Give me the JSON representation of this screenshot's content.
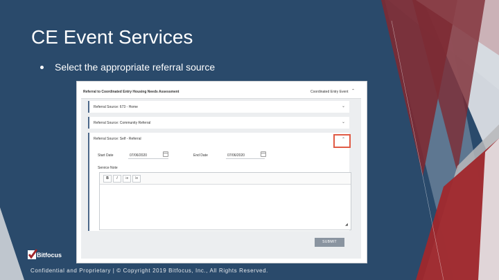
{
  "slide": {
    "title": "CE Event Services",
    "bullet": "Select the appropriate referral source",
    "footer": "Confidential and Proprietary | © Copyright 2019 Bitfocus, Inc., All Rights Reserved.",
    "logo_text": "Bitfocus"
  },
  "app": {
    "page_header": "Referral to Coordinated Entry Housing Needs Assessment",
    "header_right": "Coordinated Entry Event",
    "panels": [
      {
        "label": "Referral Source: 673 - Home"
      },
      {
        "label": "Referral Source: Community Referral"
      },
      {
        "label": "Referral Source: Self - Referral"
      }
    ],
    "start_date_label": "Start Date",
    "start_date_value": "07/06/2020",
    "end_date_label": "End Date",
    "end_date_value": "07/06/2020",
    "service_note_label": "Service Note",
    "toolbar": {
      "bold": "B",
      "italic": "I",
      "list1": "⁝≡",
      "list2": "⁞≡"
    },
    "submit_label": "SUBMIT"
  },
  "colors": {
    "background": "#2a4a6b",
    "accent_red": "#a0272c",
    "highlight": "#e05a44"
  }
}
